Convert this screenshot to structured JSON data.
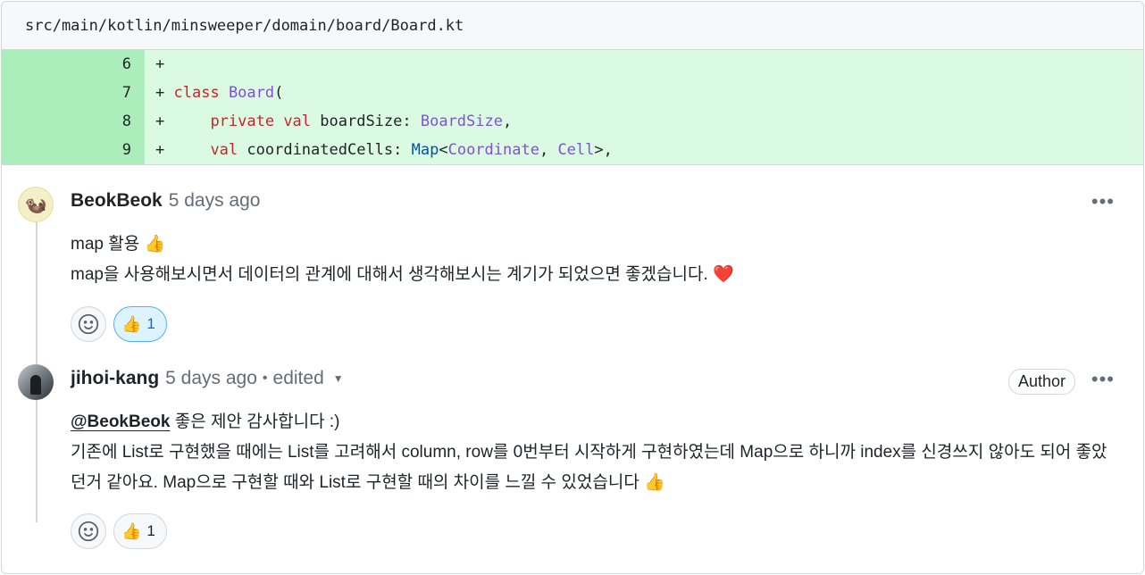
{
  "file": {
    "path": "src/main/kotlin/minsweeper/domain/board/Board.kt"
  },
  "diff": {
    "lines": [
      {
        "num": "6",
        "marker": "+"
      },
      {
        "num": "7",
        "marker": "+"
      },
      {
        "num": "8",
        "marker": "+"
      },
      {
        "num": "9",
        "marker": "+"
      }
    ]
  },
  "comments": [
    {
      "author": "BeokBeok",
      "time": "5 days ago",
      "body_line1": "map 활용 👍",
      "body_line2": "map을 사용해보시면서 데이터의 관계에 대해서 생각해보시는 계기가 되었으면 좋겠습니다. ❤️",
      "reaction": {
        "emoji": "👍",
        "count": "1",
        "active": true
      }
    },
    {
      "author": "jihoi-kang",
      "time": "5 days ago",
      "separator": "•",
      "edited": "edited",
      "badge": "Author",
      "mention": "@BeokBeok",
      "body_line1_rest": " 좋은 제안 감사합니다 :)",
      "body_line2": "기존에 List로 구현했을 때에는 List를 고려해서 column, row를 0번부터 시작하게 구현하였는데 Map으로 하니까 index를 신경쓰지 않아도 되어 좋았던거 같아요. Map으로 구현할 때와 List로 구현할 때의 차이를 느낄 수 있었습니다 👍",
      "reaction": {
        "emoji": "👍",
        "count": "1",
        "active": false
      }
    }
  ],
  "icons": {
    "menu": "kebab-horizontal-icon",
    "add_reaction": "smiley-icon",
    "edited_menu": "triangle-down-icon"
  },
  "colors": {
    "added_line_bg": "#dafbe1",
    "added_num_bg": "#aceebb",
    "keyword": "#cf222e",
    "type": "#8250df",
    "active_reaction_bg": "#ddf4ff"
  }
}
